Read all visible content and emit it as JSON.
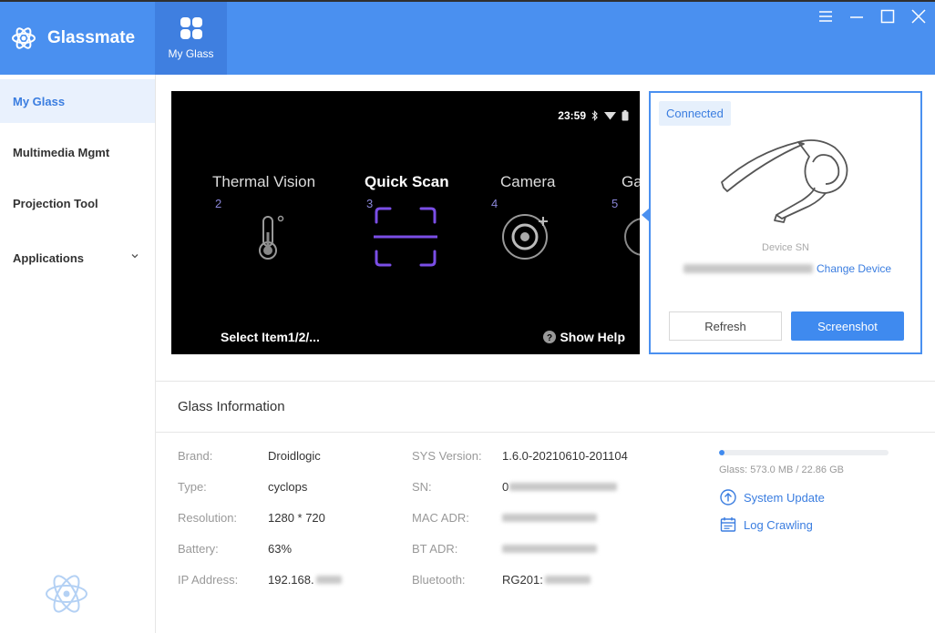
{
  "app": {
    "name": "Glassmate",
    "top_tab": "My Glass"
  },
  "window_controls": [
    "menu-icon",
    "minimize-icon",
    "maximize-icon",
    "close-icon"
  ],
  "sidebar": {
    "items": [
      {
        "label": "My Glass",
        "active": true
      },
      {
        "label": "Multimedia Mgmt",
        "active": false
      },
      {
        "label": "Projection Tool",
        "active": false
      },
      {
        "label": "Applications",
        "active": false,
        "expandable": true
      }
    ]
  },
  "screen": {
    "time": "23:59",
    "apps": [
      {
        "label": "Thermal Vision",
        "num": "2",
        "icon": "thermometer-icon"
      },
      {
        "label": "Quick Scan",
        "num": "3",
        "icon": "scan-icon",
        "selected": true
      },
      {
        "label": "Camera",
        "num": "4",
        "icon": "camera-icon"
      },
      {
        "label": "Ga",
        "num": "5",
        "icon": "partial-icon"
      }
    ],
    "footer_left": "Select Item1/2/...",
    "footer_right": "Show Help"
  },
  "device": {
    "status": "Connected",
    "sn_label": "Device SN",
    "change_label": "Change Device",
    "refresh_label": "Refresh",
    "screenshot_label": "Screenshot"
  },
  "info": {
    "title": "Glass Information",
    "left": [
      {
        "label": "Brand:",
        "value": "Droidlogic"
      },
      {
        "label": "Type:",
        "value": "cyclops"
      },
      {
        "label": "Resolution:",
        "value": "1280 * 720"
      },
      {
        "label": "Battery:",
        "value": "63%"
      },
      {
        "label": "IP Address:",
        "value": "192.168."
      }
    ],
    "right": [
      {
        "label": "SYS Version:",
        "value": "1.6.0-20210610-201104"
      },
      {
        "label": "SN:",
        "value": "0"
      },
      {
        "label": "MAC ADR:",
        "value": ""
      },
      {
        "label": "BT ADR:",
        "value": ""
      },
      {
        "label": "Bluetooth:",
        "value": "RG201:"
      }
    ],
    "storage_text": "Glass: 573.0 MB / 22.86 GB",
    "storage_fraction": 0.025,
    "system_update_label": "System Update",
    "log_crawling_label": "Log Crawling"
  },
  "colors": {
    "primary": "#4a90f0",
    "active_bg": "#e9f1fd",
    "accent_purple": "#7a4ee6"
  }
}
